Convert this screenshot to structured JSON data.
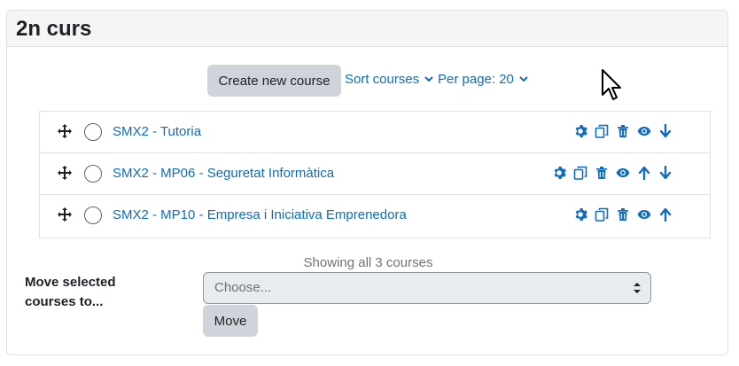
{
  "category": {
    "title": "2n curs"
  },
  "toolbar": {
    "create_label": "Create new course",
    "sort_label": "Sort courses",
    "perpage_label": "Per page: 20"
  },
  "courses": [
    {
      "name": "SMX2 - Tutoria",
      "actions": [
        "gear-icon",
        "copy-icon",
        "trash-icon",
        "eye-icon",
        "arrow-down-icon"
      ]
    },
    {
      "name": "SMX2 - MP06 - Seguretat Informàtica",
      "actions": [
        "gear-icon",
        "copy-icon",
        "trash-icon",
        "eye-icon",
        "arrow-up-icon",
        "arrow-down-icon"
      ]
    },
    {
      "name": "SMX2 - MP10 - Empresa i Iniciativa Emprenedora",
      "actions": [
        "gear-icon",
        "copy-icon",
        "trash-icon",
        "eye-icon",
        "arrow-up-icon"
      ]
    }
  ],
  "listing": {
    "showing_text": "Showing all 3 courses"
  },
  "bulk": {
    "move_label": "Move selected courses to...",
    "select_placeholder": "Choose...",
    "move_button": "Move"
  },
  "colors": {
    "link": "#0f6cbf",
    "button_bg": "#ced4da",
    "header_bg": "#f5f5f5"
  }
}
